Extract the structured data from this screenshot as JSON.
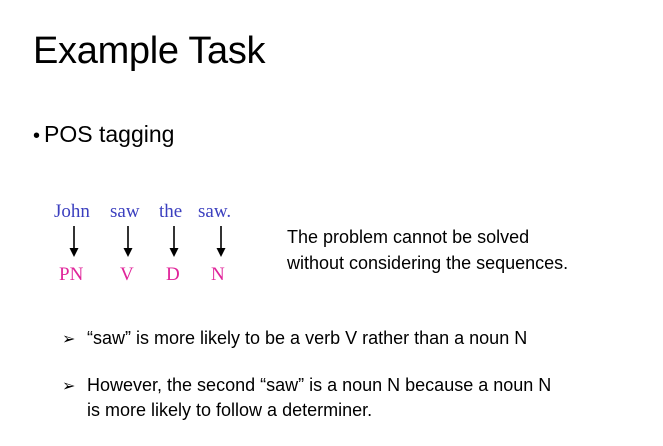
{
  "slide": {
    "title": "Example Task",
    "bullet": {
      "marker": "•",
      "text": "POS tagging"
    },
    "words": [
      "John",
      "saw",
      "the",
      "saw."
    ],
    "tags": [
      "PN",
      "V",
      "D",
      "N"
    ],
    "note_lines": [
      "The problem cannot be solved",
      "without considering the sequences."
    ],
    "points": [
      {
        "marker": "➢",
        "lines": [
          "“saw” is more likely to be a verb V rather than a noun N"
        ]
      },
      {
        "marker": "➢",
        "lines": [
          "However, the second “saw” is a noun N because a noun N",
          "is more likely to follow a determiner."
        ]
      }
    ],
    "colors": {
      "words": "#3b3fbf",
      "tags": "#e0249a",
      "text": "#000000"
    }
  }
}
